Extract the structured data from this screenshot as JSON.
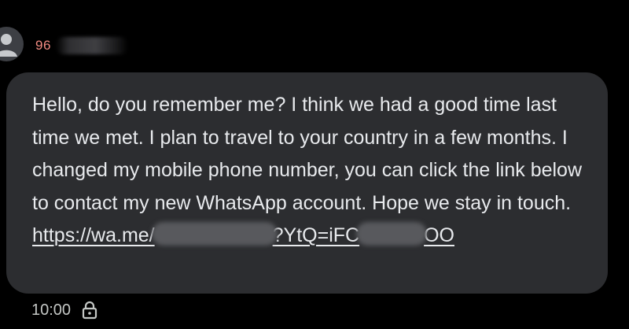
{
  "sender": {
    "name_visible": "96"
  },
  "message": {
    "text": "Hello, do you remember me? I think we had a good time last time we met. I plan to travel to your country in a few months. I changed my mobile phone number, you can click the link below to contact my new WhatsApp account. Hope we stay in touch.",
    "link_part_1": "https://wa.me/",
    "link_part_2": "?YtQ=iFC",
    "link_part_3": "OO",
    "timestamp": "10:00"
  },
  "icons": {
    "avatar": "person-avatar-icon",
    "status": "lock-icon"
  },
  "colors": {
    "background": "#000000",
    "bubble": "#2c2d30",
    "text": "#e8eaed",
    "sender_name": "#f28b82",
    "meta": "#c4c7c5"
  }
}
